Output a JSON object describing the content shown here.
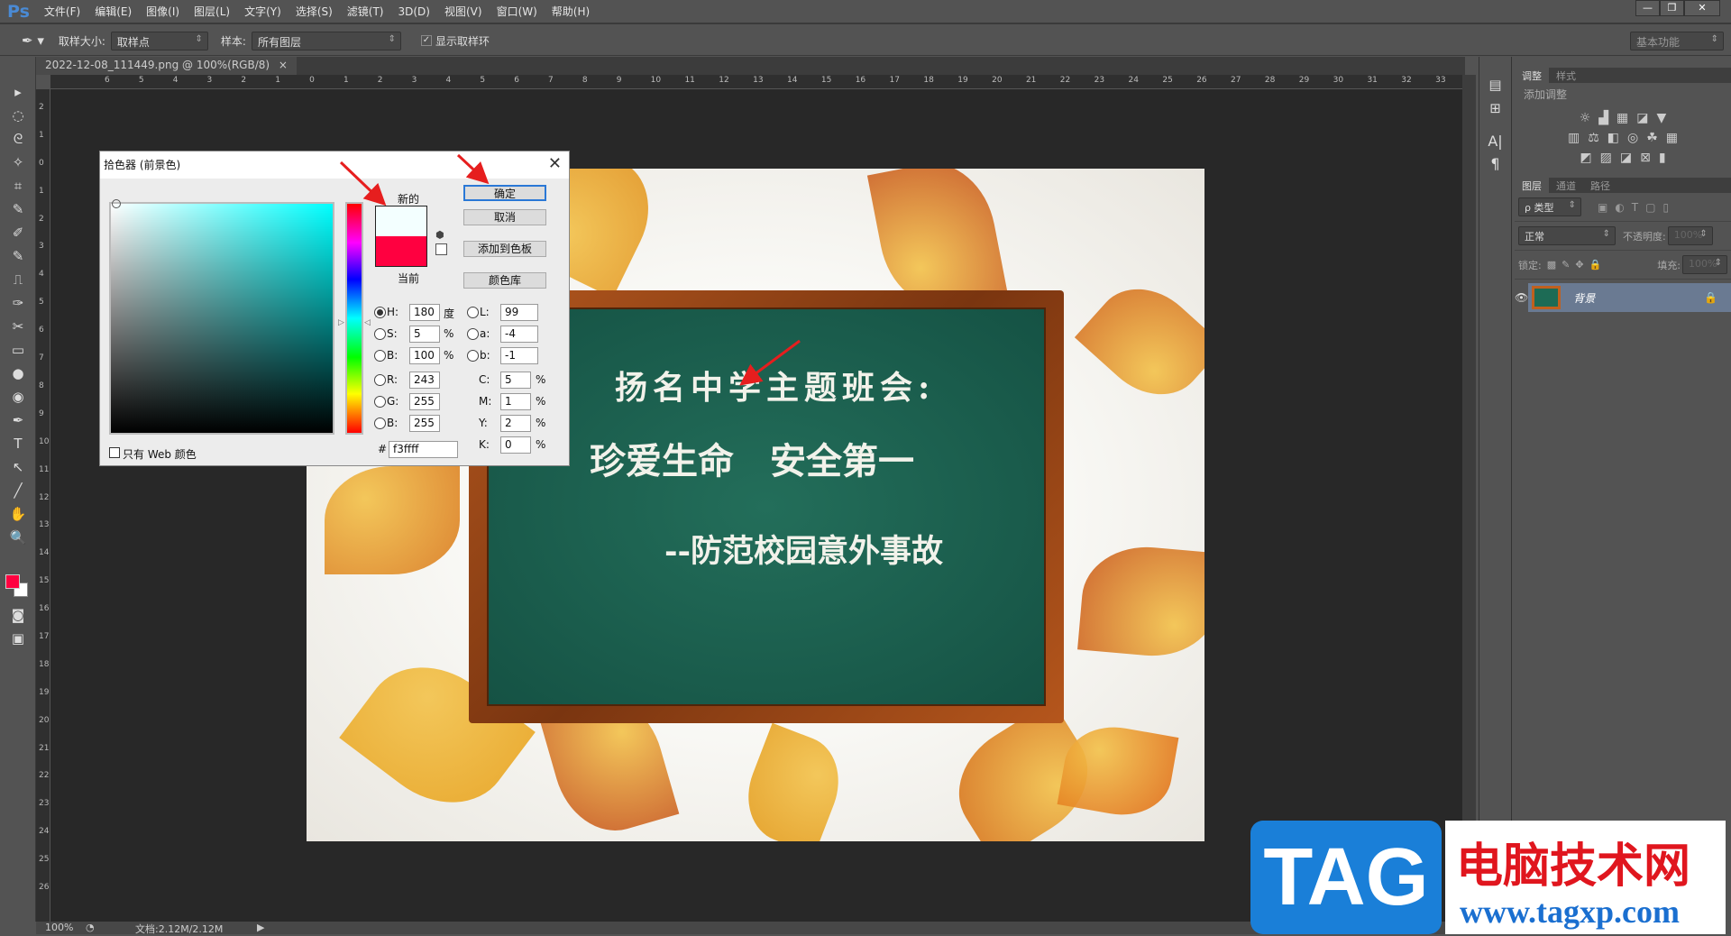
{
  "app": {
    "logo": "Ps",
    "menu": [
      "文件(F)",
      "编辑(E)",
      "图像(I)",
      "图层(L)",
      "文字(Y)",
      "选择(S)",
      "滤镜(T)",
      "3D(D)",
      "视图(V)",
      "窗口(W)",
      "帮助(H)"
    ],
    "window_buttons": [
      "—",
      "❐",
      "✕"
    ]
  },
  "options": {
    "sample_size_label": "取样大小:",
    "sample_size_value": "取样点",
    "sample_label": "样本:",
    "sample_value": "所有图层",
    "show_ring_label": "显示取样环",
    "show_ring_checked": true,
    "workspace": "基本功能"
  },
  "document": {
    "tab_title": "2022-12-08_111449.png @ 100%(RGB/8)",
    "tab_close": "×",
    "zoom": "100%",
    "doc_info": "文档:2.12M/2.12M"
  },
  "rulers": {
    "horizontal": [
      "6",
      "5",
      "4",
      "3",
      "2",
      "1",
      "0",
      "1",
      "2",
      "3",
      "4",
      "5",
      "6",
      "7",
      "8",
      "9",
      "10",
      "11",
      "12",
      "13",
      "14",
      "15",
      "16",
      "17",
      "18",
      "19",
      "20",
      "21",
      "22",
      "23",
      "24",
      "25",
      "26",
      "27",
      "28",
      "29",
      "30",
      "31",
      "32",
      "33"
    ],
    "vertical": [
      "2",
      "1",
      "0",
      "1",
      "2",
      "3",
      "4",
      "5",
      "6",
      "7",
      "8",
      "9",
      "10",
      "11",
      "12",
      "13",
      "14",
      "15",
      "16",
      "17",
      "18",
      "19",
      "20",
      "21",
      "22",
      "23",
      "24",
      "25",
      "26"
    ]
  },
  "tools": [
    "▸",
    "◌",
    "ᘓ",
    "✧",
    "⌗",
    "✎",
    "✐",
    "✎",
    "⎍",
    "✑",
    "✂",
    "▭",
    "●",
    "◉",
    "✒",
    "T",
    "↖",
    "╱",
    "✋",
    "🔍"
  ],
  "image": {
    "line1": "扬名中学主题班会:",
    "line2": "珍爱生命　安全第一",
    "line3": "--防范校园意外事故"
  },
  "picker": {
    "title": "拾色器 (前景色)",
    "new_label": "新的",
    "current_label": "当前",
    "new_color": "#f3ffff",
    "current_color": "#ff0040",
    "buttons": {
      "ok": "确定",
      "cancel": "取消",
      "add_swatch": "添加到色板",
      "libraries": "颜色库"
    },
    "hsb": [
      {
        "label": "H:",
        "value": "180",
        "unit": "度",
        "selected": true
      },
      {
        "label": "S:",
        "value": "5",
        "unit": "%"
      },
      {
        "label": "B:",
        "value": "100",
        "unit": "%"
      }
    ],
    "rgb": [
      {
        "label": "R:",
        "value": "243"
      },
      {
        "label": "G:",
        "value": "255"
      },
      {
        "label": "B:",
        "value": "255"
      }
    ],
    "lab": [
      {
        "label": "L:",
        "value": "99"
      },
      {
        "label": "a:",
        "value": "-4"
      },
      {
        "label": "b:",
        "value": "-1"
      }
    ],
    "cmyk": [
      {
        "label": "C:",
        "value": "5",
        "unit": "%"
      },
      {
        "label": "M:",
        "value": "1",
        "unit": "%"
      },
      {
        "label": "Y:",
        "value": "2",
        "unit": "%"
      },
      {
        "label": "K:",
        "value": "0",
        "unit": "%"
      }
    ],
    "hex_label": "#",
    "hex": "f3ffff",
    "web_only_label": "只有 Web 颜色"
  },
  "adjust_panel": {
    "tabs": [
      "调整",
      "样式"
    ],
    "heading": "添加调整"
  },
  "layers_panel": {
    "tabs": [
      "图层",
      "通道",
      "路径"
    ],
    "filter": "ρ 类型",
    "blend_mode": "正常",
    "opacity_label": "不透明度:",
    "opacity": "100%",
    "lock_label": "锁定:",
    "fill_label": "填充:",
    "fill": "100%",
    "layers": [
      {
        "name": "背景",
        "visible": true,
        "locked": true
      }
    ]
  },
  "watermark": {
    "tag": "TAG",
    "site_name": "电脑技术网",
    "url": "www.tagxp.com"
  }
}
